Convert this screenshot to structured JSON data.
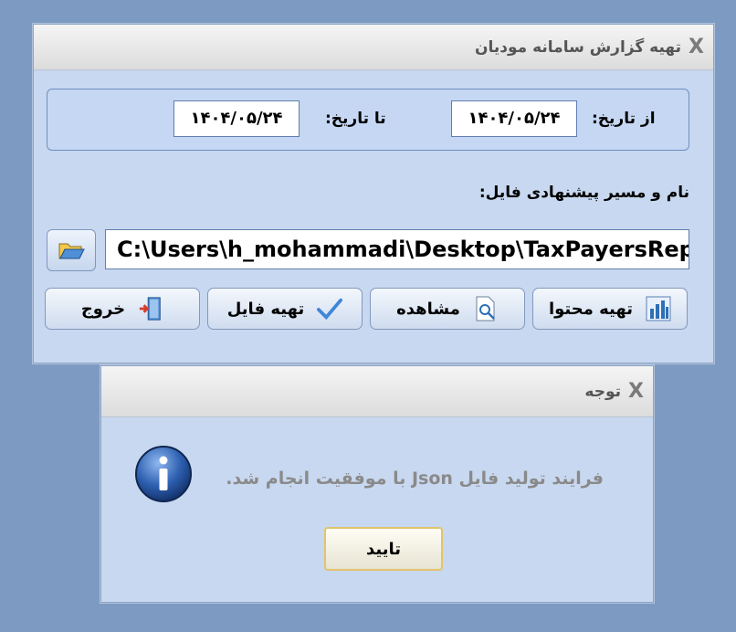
{
  "main_window": {
    "title": "تهیه گزارش سامانه مودیان",
    "close_glyph": "X",
    "from_label": "از تاریخ:",
    "from_value": "۱۴۰۴/۰۵/۲۴",
    "to_label": "تا تاریخ:",
    "to_value": "۱۴۰۴/۰۵/۲۴",
    "path_label": "نام و مسیر پیشنهادی فایل:",
    "path_value": "C:\\Users\\h_mohammadi\\Desktop\\TaxPayersReport",
    "buttons": {
      "prepare_content": "تهیه محتوا",
      "view": "مشاهده",
      "prepare_file": "تهیه فایل",
      "exit": "خروج"
    }
  },
  "dialog": {
    "title": "توجه",
    "close_glyph": "X",
    "message": "فرایند تولید فایل Json با موفقیت انجام شد.",
    "ok_label": "تایید"
  },
  "icons": {
    "folder": "folder-open-icon",
    "chart": "bar-chart-icon",
    "preview": "document-search-icon",
    "check": "checkmark-icon",
    "exit": "exit-door-icon",
    "info": "info-icon"
  },
  "colors": {
    "desktop": "#7d9bc2",
    "window": "#c8d8f0",
    "titlebar": "#e6e6e6",
    "accent": "#2f6fb8",
    "ok_border": "#e2c46a"
  }
}
